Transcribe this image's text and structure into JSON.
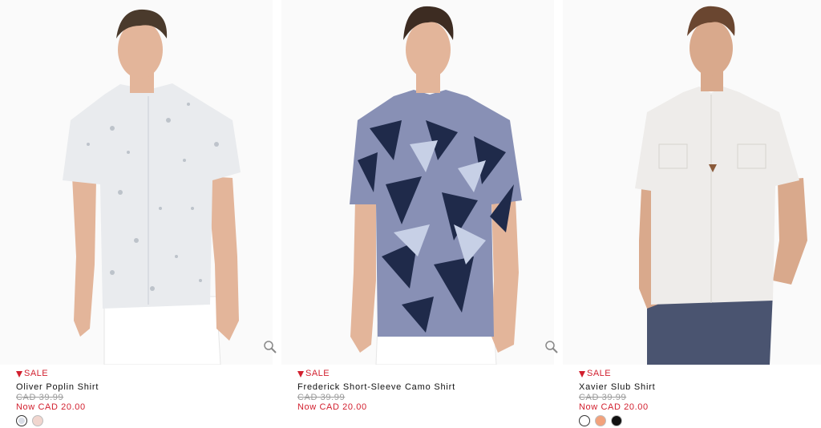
{
  "products": [
    {
      "badge": "SALE",
      "name": "Oliver Poplin Shirt",
      "was_price": "CAD 39.99",
      "now_price": "Now CAD 20.00",
      "swatches": [
        "#d9dde6",
        "#f1d6cf"
      ]
    },
    {
      "badge": "SALE",
      "name": "Frederick Short-Sleeve Camo Shirt",
      "was_price": "CAD 39.99",
      "now_price": "Now CAD 20.00",
      "swatches": []
    },
    {
      "badge": "SALE",
      "name": "Xavier Slub Shirt",
      "was_price": "CAD 39.99",
      "now_price": "Now CAD 20.00",
      "swatches": [
        "#ffffff",
        "#f2a27c",
        "#111111"
      ]
    }
  ],
  "icons": {
    "zoom": "magnifier-icon",
    "sale": "down-triangle-icon"
  },
  "colors": {
    "sale_red": "#d2202f",
    "text": "#111111",
    "strike": "#9a9a9a"
  }
}
